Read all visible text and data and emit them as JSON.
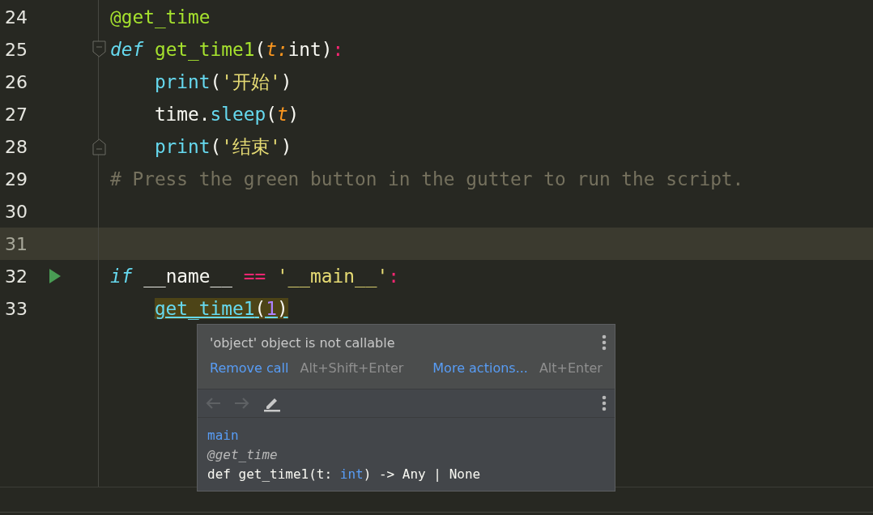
{
  "editor": {
    "lines": [
      {
        "number": "24",
        "current": false,
        "run": false,
        "fold_start": false,
        "fold_end": false,
        "indented": false,
        "tokens": [
          {
            "text": "@get_time",
            "kind": "decorator"
          }
        ]
      },
      {
        "number": "25",
        "current": false,
        "run": false,
        "fold_start": true,
        "fold_end": false,
        "indented": false,
        "tokens": [
          {
            "text": "def ",
            "kind": "keyword"
          },
          {
            "text": "get_time1",
            "kind": "function"
          },
          {
            "text": "(",
            "kind": "plain"
          },
          {
            "text": "t",
            "kind": "param"
          },
          {
            "text": ":",
            "kind": "param"
          },
          {
            "text": "int)",
            "kind": "plain"
          },
          {
            "text": ":",
            "kind": "operator"
          }
        ]
      },
      {
        "number": "26",
        "current": false,
        "run": false,
        "fold_start": false,
        "fold_end": false,
        "indented": true,
        "tokens": [
          {
            "text": "print",
            "kind": "builtin"
          },
          {
            "text": "(",
            "kind": "plain"
          },
          {
            "text": "'开始'",
            "kind": "string"
          },
          {
            "text": ")",
            "kind": "plain"
          }
        ]
      },
      {
        "number": "27",
        "current": false,
        "run": false,
        "fold_start": false,
        "fold_end": false,
        "indented": true,
        "tokens": [
          {
            "text": "time.",
            "kind": "plain"
          },
          {
            "text": "sleep",
            "kind": "builtin"
          },
          {
            "text": "(",
            "kind": "plain"
          },
          {
            "text": "t",
            "kind": "param"
          },
          {
            "text": ")",
            "kind": "plain"
          }
        ]
      },
      {
        "number": "28",
        "current": false,
        "run": false,
        "fold_start": false,
        "fold_end": true,
        "indented": true,
        "tokens": [
          {
            "text": "print",
            "kind": "builtin"
          },
          {
            "text": "(",
            "kind": "plain"
          },
          {
            "text": "'结束'",
            "kind": "string"
          },
          {
            "text": ")",
            "kind": "plain"
          }
        ]
      },
      {
        "number": "29",
        "current": false,
        "run": false,
        "fold_start": false,
        "fold_end": false,
        "indented": false,
        "tokens": [
          {
            "text": "# Press the green button in the gutter to run the script.",
            "kind": "comment"
          }
        ]
      },
      {
        "number": "30",
        "current": false,
        "run": false,
        "fold_start": false,
        "fold_end": false
      },
      {
        "number": "31",
        "current": true,
        "run": false,
        "fold_start": false,
        "fold_end": false
      },
      {
        "number": "32",
        "current": false,
        "run": true,
        "fold_start": false,
        "fold_end": false,
        "indented": false,
        "tokens": [
          {
            "text": "if",
            "kind": "keyword"
          },
          {
            "text": " __name__ ",
            "kind": "plain"
          },
          {
            "text": "==",
            "kind": "operator"
          },
          {
            "text": " '__main__'",
            "kind": "string"
          },
          {
            "text": ":",
            "kind": "operator"
          }
        ]
      },
      {
        "number": "33",
        "current": false,
        "run": false,
        "fold_start": false,
        "fold_end": false,
        "indented": true,
        "usage": [
          {
            "text": "get_time1",
            "kind": "call"
          },
          {
            "text": "(",
            "kind": "plain"
          },
          {
            "text": "1",
            "kind": "number"
          },
          {
            "text": ")",
            "kind": "plain"
          }
        ]
      }
    ]
  },
  "popup": {
    "message": "'object' object is not callable",
    "actions": [
      {
        "label": "Remove call",
        "shortcut": "Alt+Shift+Enter"
      },
      {
        "label": "More actions...",
        "shortcut": "Alt+Enter"
      }
    ],
    "toolbar": [
      {
        "kind": "back",
        "disabled": true
      },
      {
        "kind": "forward",
        "disabled": true
      },
      {
        "kind": "edit",
        "disabled": false
      }
    ],
    "doc": {
      "module": "main",
      "decorator": "@get_time",
      "signature": [
        {
          "text": "def get_time1(t: ",
          "kind": "plain"
        },
        {
          "text": "int",
          "kind": "type"
        },
        {
          "text": ") -> Any | None",
          "kind": "plain"
        }
      ]
    }
  }
}
